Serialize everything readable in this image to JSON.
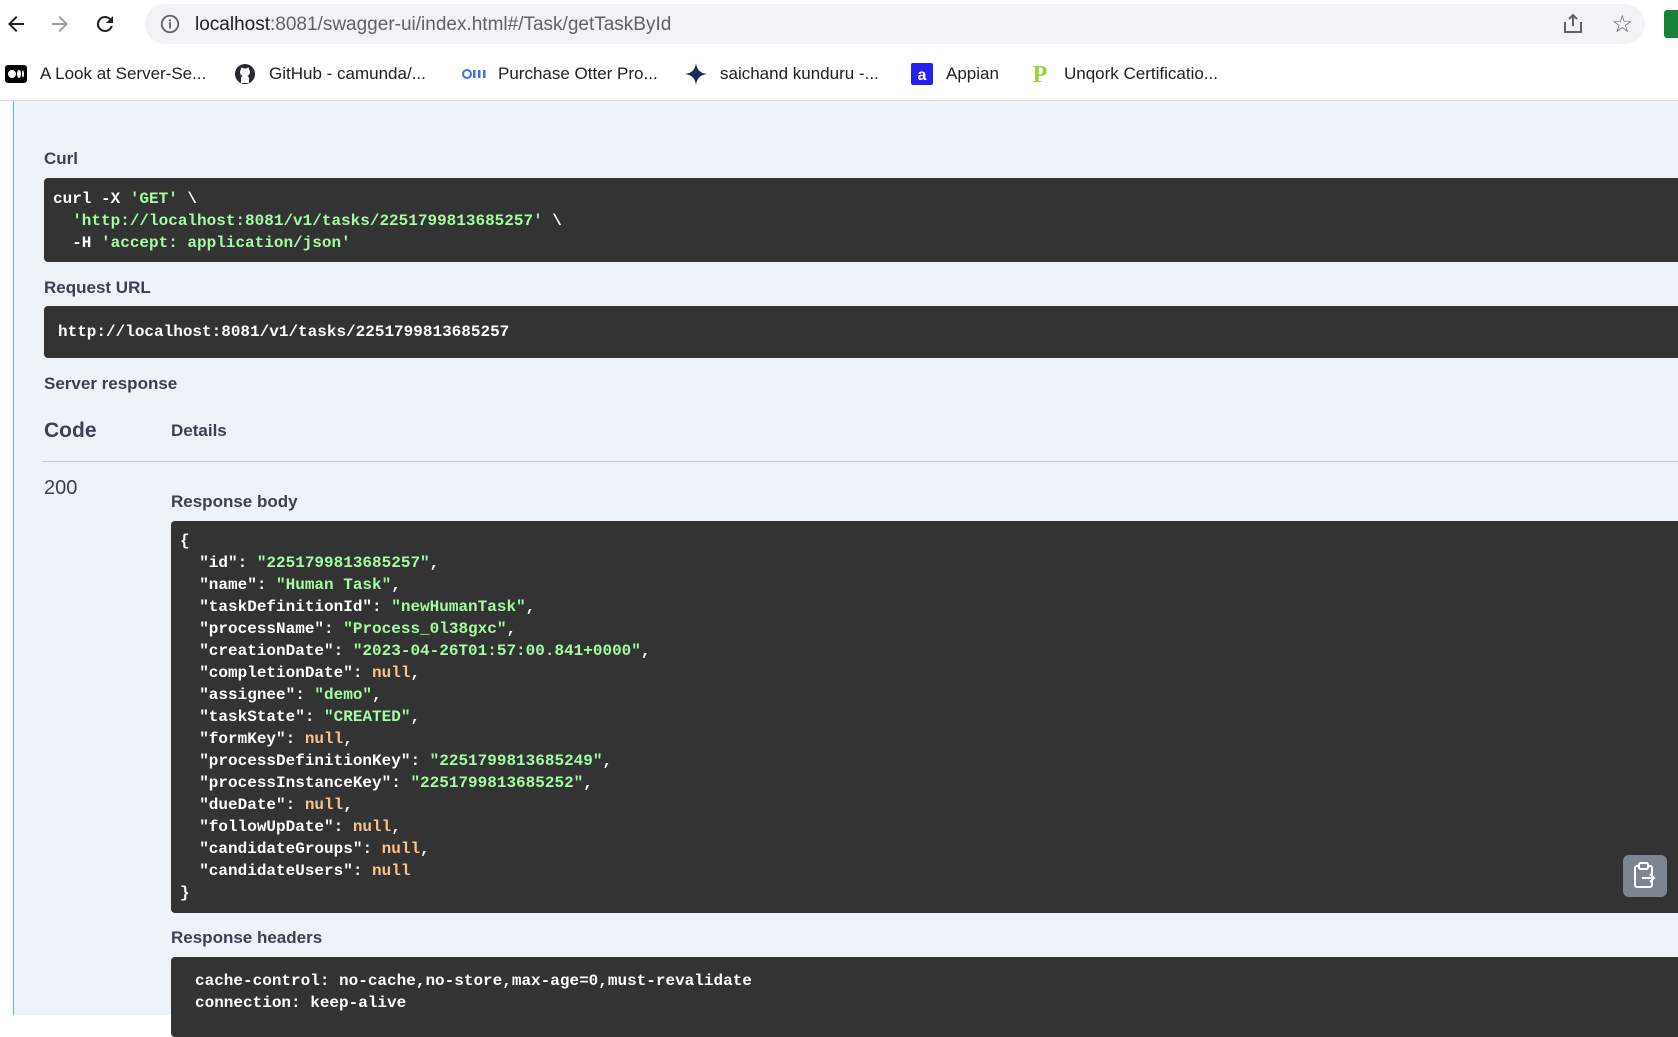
{
  "browser": {
    "url_host": "localhost",
    "url_rest": ":8081/swagger-ui/index.html#/Task/getTaskById",
    "bookmarks": [
      {
        "label": "A Look at Server-Se...",
        "icon": "medium-icon"
      },
      {
        "label": "GitHub - camunda/...",
        "icon": "github-icon"
      },
      {
        "label": "Purchase Otter Pro...",
        "icon": "otter-icon"
      },
      {
        "label": "saichand kunduru -...",
        "icon": "sparkle-icon"
      },
      {
        "label": "Appian",
        "icon": "appian-icon"
      },
      {
        "label": "Unqork Certificatio...",
        "icon": "unqork-icon"
      }
    ]
  },
  "swagger": {
    "curl_label": "Curl",
    "curl": {
      "line1_cmd": "curl -X ",
      "line1_method": "'GET'",
      "line1_end": " \\",
      "line2_indent": "  ",
      "line2_url": "'http://localhost:8081/v1/tasks/2251799813685257'",
      "line2_end": " \\",
      "line3_flag": "  -H ",
      "line3_header": "'accept: application/json'"
    },
    "request_url_label": "Request URL",
    "request_url": "http://localhost:8081/v1/tasks/2251799813685257",
    "server_response_label": "Server response",
    "code_header": "Code",
    "details_header": "Details",
    "status_code": "200",
    "response_body_label": "Response body",
    "response_body": [
      {
        "k": "\"id\"",
        "v": "\"2251799813685257\"",
        "t": "str"
      },
      {
        "k": "\"name\"",
        "v": "\"Human Task\"",
        "t": "str"
      },
      {
        "k": "\"taskDefinitionId\"",
        "v": "\"newHumanTask\"",
        "t": "str"
      },
      {
        "k": "\"processName\"",
        "v": "\"Process_0l38gxc\"",
        "t": "str"
      },
      {
        "k": "\"creationDate\"",
        "v": "\"2023-04-26T01:57:00.841+0000\"",
        "t": "str"
      },
      {
        "k": "\"completionDate\"",
        "v": "null",
        "t": "nul"
      },
      {
        "k": "\"assignee\"",
        "v": "\"demo\"",
        "t": "str"
      },
      {
        "k": "\"taskState\"",
        "v": "\"CREATED\"",
        "t": "str"
      },
      {
        "k": "\"formKey\"",
        "v": "null",
        "t": "nul"
      },
      {
        "k": "\"processDefinitionKey\"",
        "v": "\"2251799813685249\"",
        "t": "str"
      },
      {
        "k": "\"processInstanceKey\"",
        "v": "\"2251799813685252\"",
        "t": "str"
      },
      {
        "k": "\"dueDate\"",
        "v": "null",
        "t": "nul"
      },
      {
        "k": "\"followUpDate\"",
        "v": "null",
        "t": "nul"
      },
      {
        "k": "\"candidateGroups\"",
        "v": "null",
        "t": "nul"
      },
      {
        "k": "\"candidateUsers\"",
        "v": "null",
        "t": "nul"
      }
    ],
    "open_brace": "{",
    "close_brace": "}",
    "response_headers_label": "Response headers",
    "response_headers": [
      "cache-control: no-cache,no-store,max-age=0,must-revalidate",
      "connection: keep-alive"
    ]
  },
  "colors": {
    "code_bg": "#333333",
    "string": "#a2fca2",
    "null": "#fcc28c",
    "panel_bg": "#eef2f9"
  }
}
